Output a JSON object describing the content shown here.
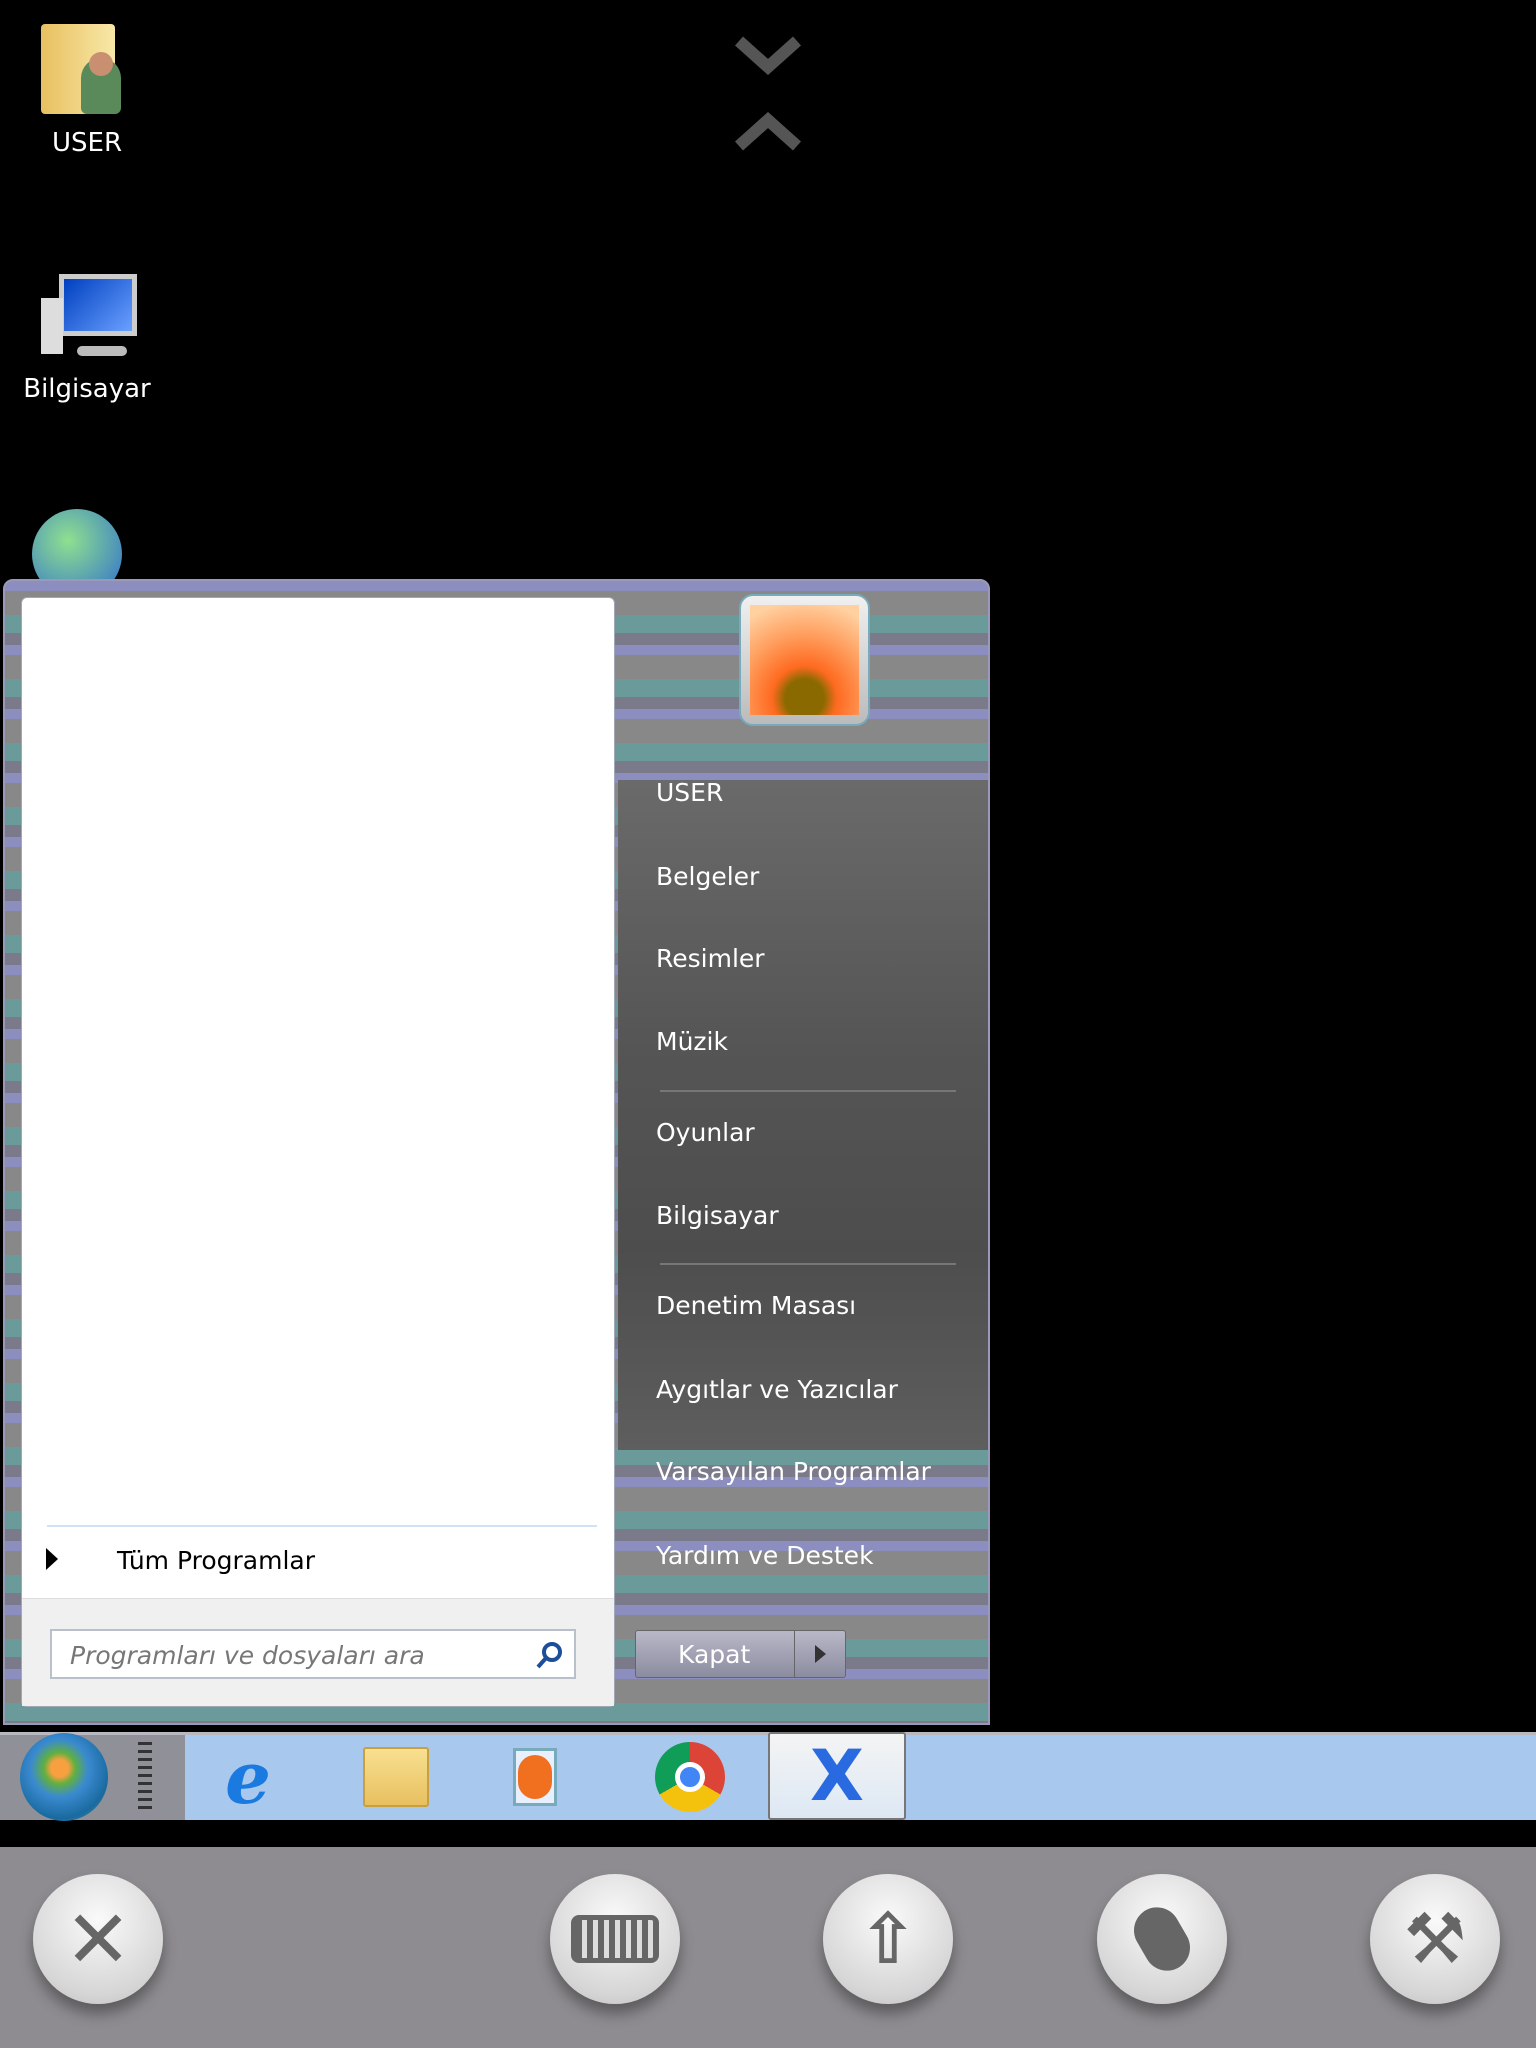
{
  "desktop": {
    "icons": [
      {
        "label": "USER"
      },
      {
        "label": "Bilgisayar"
      }
    ]
  },
  "start_menu": {
    "all_programs": "Tüm Programlar",
    "search_placeholder": "Programları ve dosyaları ara",
    "right_items": [
      "USER",
      "Belgeler",
      "Resimler",
      "Müzik",
      "Oyunlar",
      "Bilgisayar",
      "Denetim Masası",
      "Aygıtlar ve Yazıcılar",
      "Varsayılan Programlar",
      "Yardım ve Destek"
    ],
    "shutdown_label": "Kapat"
  },
  "taskbar": {
    "items": [
      "start-orb",
      "internet-explorer-icon",
      "windows-explorer-icon",
      "media-player-icon",
      "chrome-icon",
      "remote-app-icon"
    ]
  },
  "toolbar": {
    "buttons": [
      "close",
      "keyboard",
      "function-keys",
      "mouse",
      "settings"
    ]
  },
  "colors": {
    "taskbar": "#a8c8ee",
    "toolbar": "#8e8c90"
  }
}
